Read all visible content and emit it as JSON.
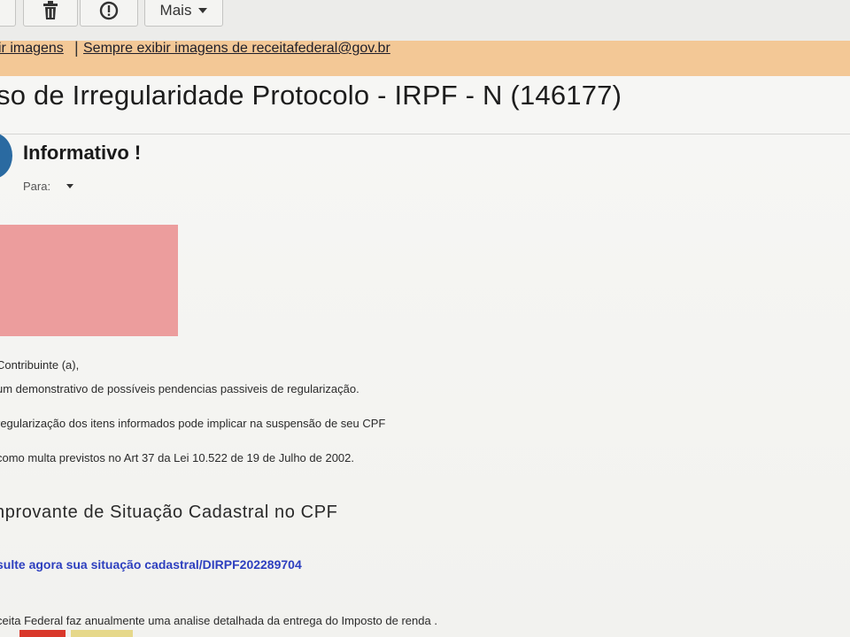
{
  "toolbar": {
    "delete_icon": "trash-icon",
    "spam_icon": "report-spam-icon",
    "more_label": "Mais",
    "more_icon": "chevron-down-icon"
  },
  "images_bar": {
    "show_images_label": "ir imagens",
    "separator": "|",
    "always_show_label": "Sempre exibir imagens de receitafederal@gov.br"
  },
  "email": {
    "subject": "so de Irregularidade Protocolo - IRPF - N (146177)",
    "sender_name": "Informativo !",
    "to_label": "Para:",
    "body": {
      "greeting": "Contribuinte (a),",
      "line1": "um demonstrativo de possíveis pendencias passiveis de regularização.",
      "line2": "regularização dos itens informados pode implicar na suspensão de seu CPF",
      "line3": "como multa previstos no Art 37 da Lei 10.522 de 19 de Julho de 2002.",
      "section_title": "nprovante de Situação Cadastral no CPF",
      "link_text": "sulte agora sua situação cadastral/DIRPF202289704",
      "footer_line": "ceita Federal faz anualmente uma analise detalhada da entrega do Imposto de renda ."
    }
  },
  "colors": {
    "images_bar_bg": "#f3c896",
    "link_blue": "#2d3fbf",
    "redacted": "#ec9d9d",
    "avatar": "#2a6aa1"
  }
}
